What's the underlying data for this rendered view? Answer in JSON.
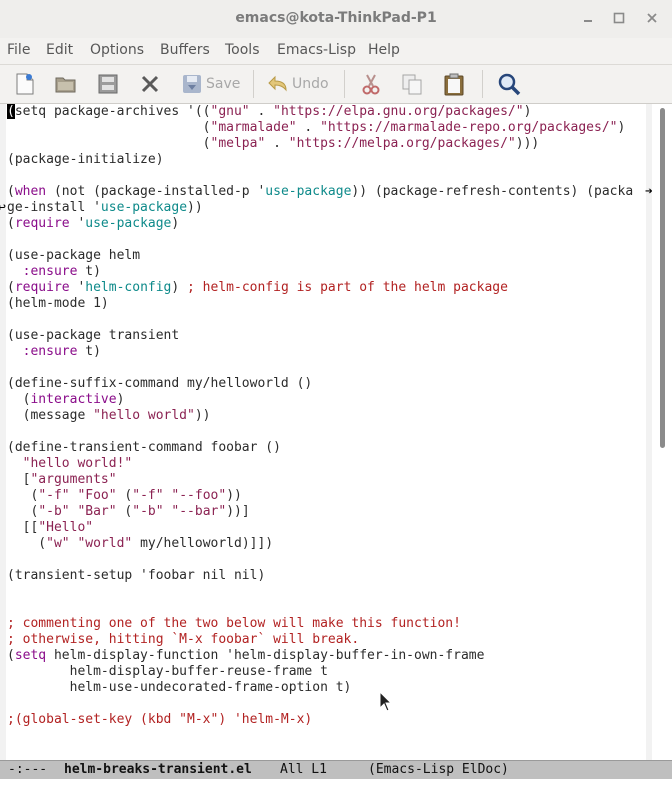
{
  "window": {
    "title": "emacs@kota-ThinkPad-P1",
    "buttons": [
      "minimize",
      "maximize",
      "close"
    ]
  },
  "menubar": {
    "items": [
      "File",
      "Edit",
      "Options",
      "Buffers",
      "Tools",
      "Emacs-Lisp",
      "Help"
    ]
  },
  "toolbar": {
    "save_label": "Save",
    "undo_label": "Undo"
  },
  "editor": {
    "lines": [
      "(setq package-archives '((\"gnu\" . \"https://elpa.gnu.org/packages/\")",
      "                         (\"marmalade\" . \"https://marmalade-repo.org/packages/\")",
      "                         (\"melpa\" . \"https://melpa.org/packages/\")))",
      "(package-initialize)",
      "",
      "(when (not (package-installed-p 'use-package)) (package-refresh-contents) (packa",
      "ge-install 'use-package))",
      "(require 'use-package)",
      "",
      "(use-package helm",
      "  :ensure t)",
      "(require 'helm-config) ; helm-config is part of the helm package",
      "(helm-mode 1)",
      "",
      "(use-package transient",
      "  :ensure t)",
      "",
      "(define-suffix-command my/helloworld ()",
      "  (interactive)",
      "  (message \"hello world\"))",
      "",
      "(define-transient-command foobar ()",
      "  \"hello world!\"",
      "  [\"arguments\"",
      "   (\"-f\" \"Foo\" (\"-f\" \"--foo\"))",
      "   (\"-b\" \"Bar\" (\"-b\" \"--bar\"))]",
      "  [[\"Hello\"",
      "    (\"w\" \"world\" my/helloworld)]])",
      "",
      "(transient-setup 'foobar nil nil)",
      "",
      "",
      "; commenting one of the two below will make this function!",
      "; otherwise, hitting `M-x foobar` will break.",
      "(setq helm-display-function 'helm-display-buffer-in-own-frame",
      "        helm-display-buffer-reuse-frame t",
      "        helm-use-undecorated-frame-option t)",
      "",
      ";(global-set-key (kbd \"M-x\") 'helm-M-x)"
    ]
  },
  "modeline": {
    "status": "-:---",
    "buffer_name": "helm-breaks-transient.el",
    "position": "All L1",
    "modes": "(Emacs-Lisp ElDoc)"
  }
}
